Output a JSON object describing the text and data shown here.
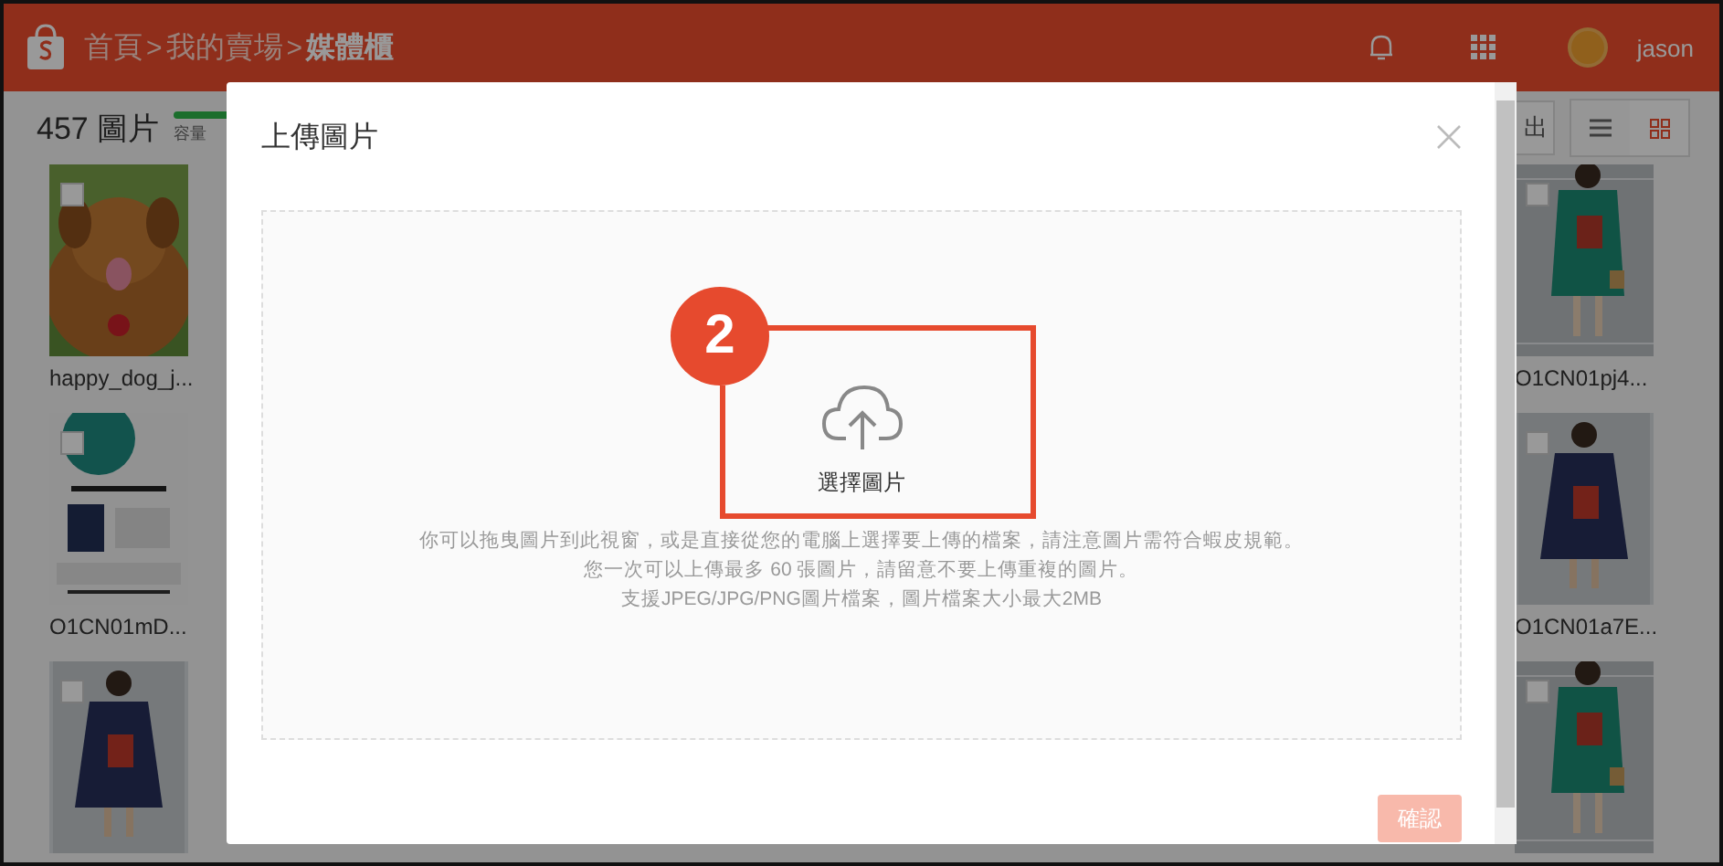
{
  "header": {
    "breadcrumb": [
      {
        "label": "首頁",
        "current": false
      },
      {
        "label": "我的賣場",
        "current": false
      },
      {
        "label": "媒體櫃",
        "current": true
      }
    ],
    "separator": ">",
    "user": "jason"
  },
  "toolbar": {
    "count": "457 圖片",
    "storage_label": "容量",
    "export_label": "出",
    "views": [
      {
        "kind": "list",
        "selected": false
      },
      {
        "kind": "grid",
        "selected": true
      }
    ]
  },
  "media_left": [
    {
      "kind": "dog",
      "name": "happy_dog_j...",
      "checked": false
    },
    {
      "kind": "sheet",
      "name": "O1CN01mD...",
      "checked": false
    },
    {
      "kind": "navy",
      "checked": false
    }
  ],
  "media_right": [
    {
      "kind": "green",
      "name": "O1CN01pj4...",
      "checked": false
    },
    {
      "kind": "navy",
      "name": "O1CN01a7E...",
      "checked": false
    },
    {
      "kind": "green",
      "checked": false
    }
  ],
  "modal": {
    "title": "上傳圖片",
    "choose_label": "選擇圖片",
    "hints": [
      "你可以拖曳圖片到此視窗，或是直接從您的電腦上選擇要上傳的檔案，請注意圖片需符合蝦皮規範。",
      "您一次可以上傳最多 60 張圖片，請留意不要上傳重複的圖片。",
      "支援JPEG/JPG/PNG圖片檔案，圖片檔案大小最大2MB"
    ],
    "confirm": {
      "label": "確認",
      "disabled": true
    }
  },
  "annotation": {
    "number": "2"
  }
}
